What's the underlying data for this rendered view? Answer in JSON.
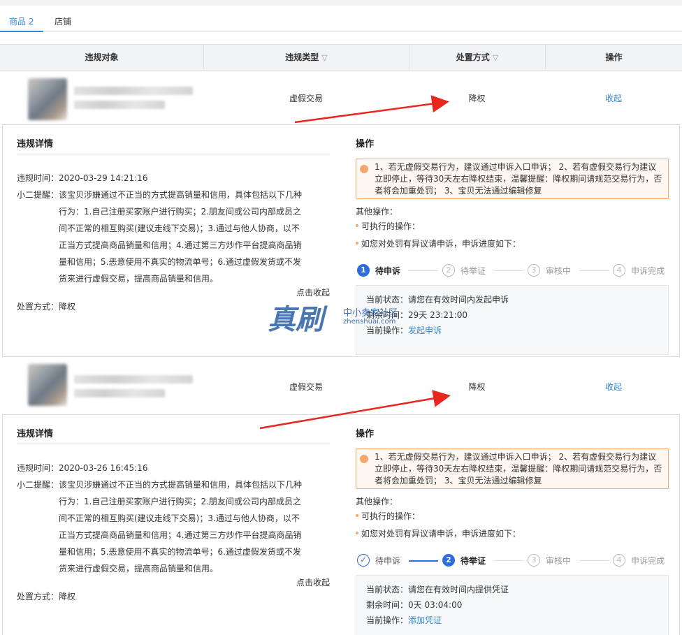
{
  "tabs": [
    {
      "label": "商品 2",
      "active": true
    },
    {
      "label": "店铺",
      "active": false
    }
  ],
  "table": {
    "headers": [
      "违规对象",
      "违规类型",
      "处置方式",
      "操作"
    ]
  },
  "records": [
    {
      "violation_type": "虚假交易",
      "action": "降权",
      "collapse_label": "收起",
      "detail": {
        "title": "违规详情",
        "time": "违规时间：2020-03-29 14:21:16",
        "remind_label": "小二提醒：",
        "remind_lines": [
          "该宝贝涉嫌通过不正当的方式提高销量和信用，具体包括以下几种",
          "行为：1.自己注册买家账户进行购买；2.朋友间或公司内部成员之",
          "间不正常的相互购买(建议走线下交易)；3.通过与他人协商，以不",
          "正当方式提高商品销量和信用；4.通过第三方炒作平台提高商品销",
          "量和信用；5.恶意使用不真实的物流单号；6.通过虚假发货或不发",
          "货来进行虚假交易，提高商品销量和信用。"
        ],
        "collapse_link": "点击收起",
        "disposal": "处置方式：降权"
      },
      "ops": {
        "title": "操作",
        "notice": "1、若无虚假交易行为，建议通过申诉入口申诉； 2、若有虚假交易行为建议立即停止，等待30天左右降权结束，温馨提醒：降权期间请规范交易行为，否者将会加重处罚； 3、宝贝无法通过编辑修复",
        "other_label": "其他操作：",
        "bullet1": "可执行的操作：",
        "bullet2": "如您对处罚有异议请申诉，申诉进度如下：",
        "steps": [
          {
            "num": "1",
            "label": "待申诉",
            "state": "active"
          },
          {
            "num": "2",
            "label": "待举证",
            "state": "pending"
          },
          {
            "num": "3",
            "label": "审核中",
            "state": "pending"
          },
          {
            "num": "4",
            "label": "申诉完成",
            "state": "pending"
          }
        ],
        "status": "当前状态：请您在有效时间内发起申诉",
        "remain": "剩余时间：29天 23:21:00",
        "current_op_label": "当前操作：",
        "current_op_link": "发起申诉"
      }
    },
    {
      "violation_type": "虚假交易",
      "action": "降权",
      "collapse_label": "收起",
      "detail": {
        "title": "违规详情",
        "time": "违规时间：2020-03-26 16:45:16",
        "remind_label": "小二提醒：",
        "remind_lines": [
          "该宝贝涉嫌通过不正当的方式提高销量和信用，具体包括以下几种",
          "行为：1.自己注册买家账户进行购买；2.朋友间或公司内部成员之",
          "间不正常的相互购买(建议走线下交易)；3.通过与他人协商，以不",
          "正当方式提高商品销量和信用；4.通过第三方炒作平台提高商品销",
          "量和信用；5.恶意使用不真实的物流单号；6.通过虚假发货或不发",
          "货来进行虚假交易，提高商品销量和信用。"
        ],
        "collapse_link": "点击收起",
        "disposal": "处置方式：降权"
      },
      "ops": {
        "title": "操作",
        "notice": "1、若无虚假交易行为，建议通过申诉入口申诉； 2、若有虚假交易行为建议立即停止，等待30天左右降权结束，温馨提醒：降权期间请规范交易行为，否者将会加重处罚； 3、宝贝无法通过编辑修复",
        "other_label": "其他操作：",
        "bullet1": "可执行的操作：",
        "bullet2": "如您对处罚有异议请申诉，申诉进度如下：",
        "steps": [
          {
            "num": "✓",
            "label": "待申诉",
            "state": "done"
          },
          {
            "num": "2",
            "label": "待举证",
            "state": "active"
          },
          {
            "num": "3",
            "label": "审核中",
            "state": "pending"
          },
          {
            "num": "4",
            "label": "申诉完成",
            "state": "pending"
          }
        ],
        "status": "当前状态：请您在有效时间内提供凭证",
        "remain": "剩余时间：0天 03:04:00",
        "current_op_label": "当前操作：",
        "current_op_link": "添加凭证"
      }
    }
  ],
  "watermark": {
    "main": "真刷",
    "sub": "中小卖家社区",
    "domain": "zhenshuai.com"
  },
  "colors": {
    "accent": "#3089dc",
    "step_active": "#2d6cdf",
    "notice_border": "#f5a76c",
    "arrow": "#e8271e"
  }
}
